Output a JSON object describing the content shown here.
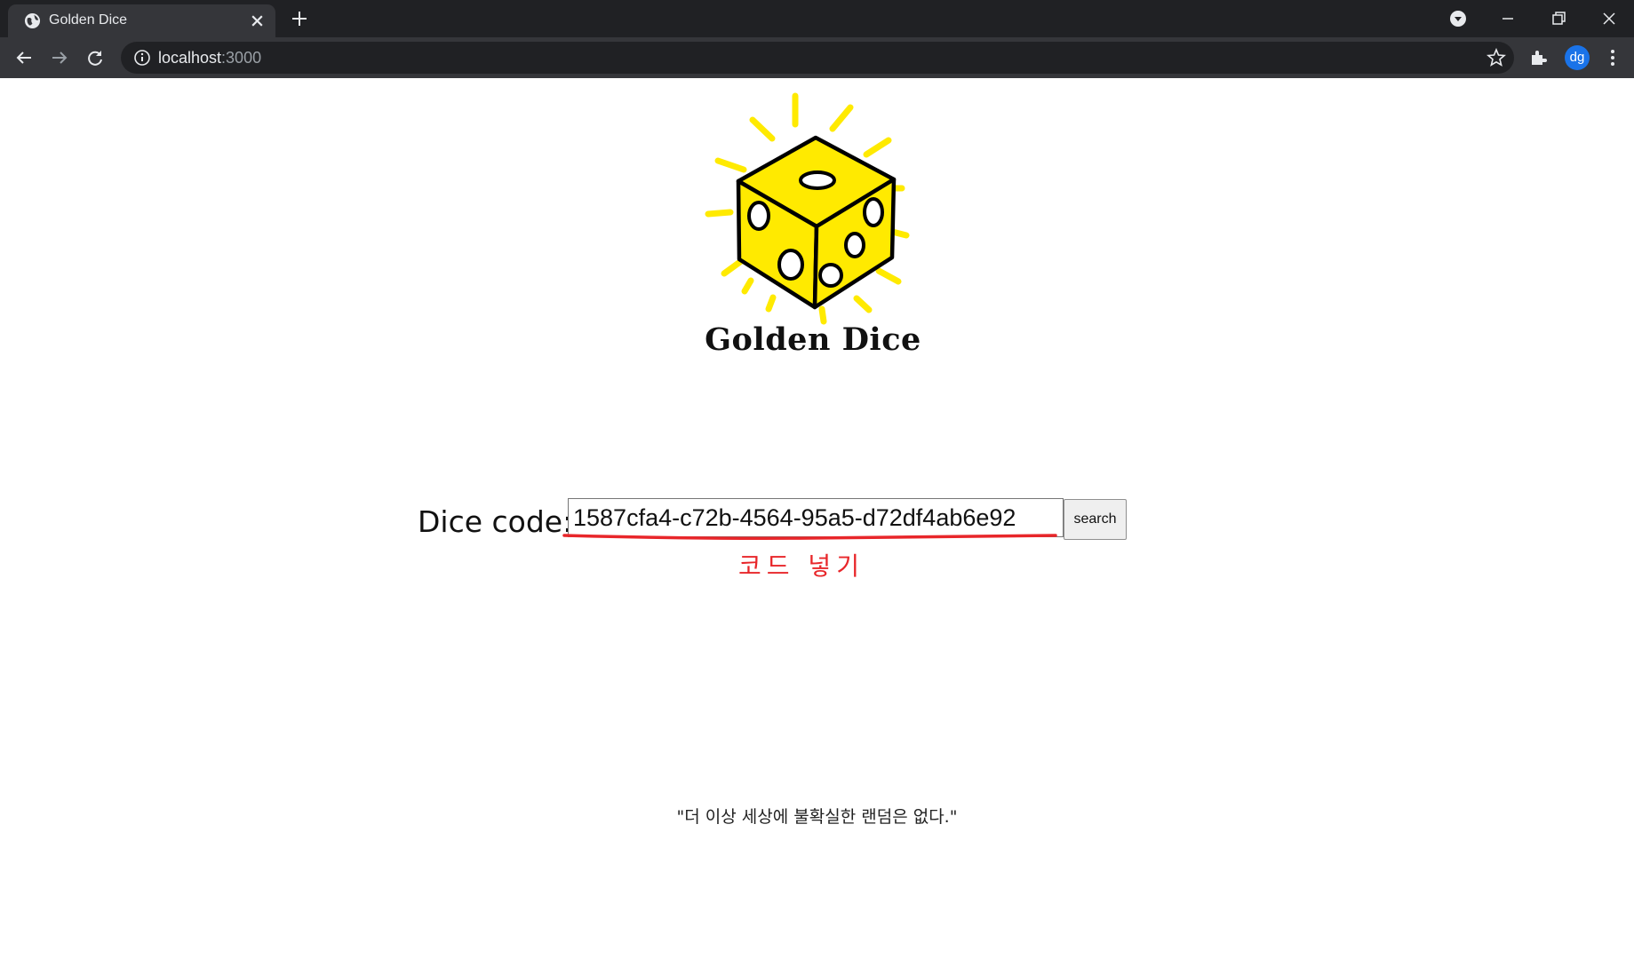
{
  "browser": {
    "tab_title": "Golden Dice",
    "url_host": "localhost",
    "url_port": ":3000",
    "profile_initials": "dg"
  },
  "logo": {
    "text": "Golden Dice",
    "accent_color": "#ffea00"
  },
  "search": {
    "label": "Dice code:",
    "value": "1587cfa4-c72b-4564-95a5-d72df4ab6e92",
    "button_label": "search"
  },
  "annotation": {
    "caption": "코드 넣기",
    "color": "#e8262a"
  },
  "footer": {
    "quote": "\"더 이상 세상에 불확실한 랜덤은 없다.\""
  }
}
